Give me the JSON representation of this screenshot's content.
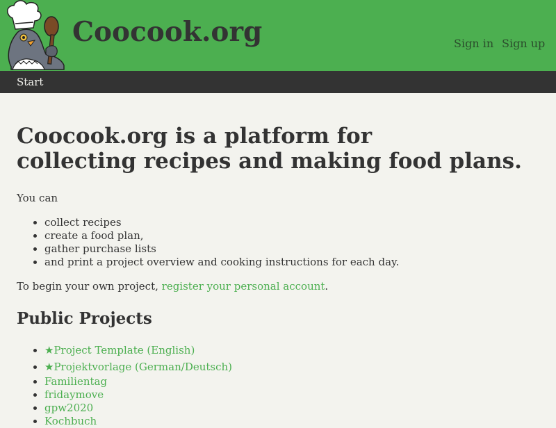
{
  "header": {
    "site_title": "Coocook.org",
    "sign_in": "Sign in",
    "sign_up": "Sign up",
    "logo_icon": "chef-pigeon-with-spoon-logo",
    "colors": {
      "header_bg": "#4caf50",
      "link_green": "#4caf50",
      "nav_bg": "#333333",
      "page_bg": "#f3f3ee"
    }
  },
  "nav": {
    "items": [
      {
        "label": "Start"
      }
    ]
  },
  "main": {
    "headline_line1": "Coocook.org is a platform for",
    "headline_line2": "collecting recipes and making food plans.",
    "intro": "You can",
    "features": [
      "collect recipes",
      "create a food plan,",
      "gather purchase lists",
      "and print a project overview and cooking instructions for each day."
    ],
    "cta_prefix": "To begin your own project, ",
    "cta_link": "register your personal account",
    "cta_suffix": ".",
    "projects_title": "Public Projects",
    "projects": [
      {
        "star": "★",
        "label": "Project Template (English)"
      },
      {
        "star": "★",
        "label": "Projektvorlage (German/Deutsch)"
      },
      {
        "label": "Familientag"
      },
      {
        "label": "fridaymove"
      },
      {
        "label": "gpw2020"
      },
      {
        "label": "Kochbuch"
      }
    ]
  }
}
